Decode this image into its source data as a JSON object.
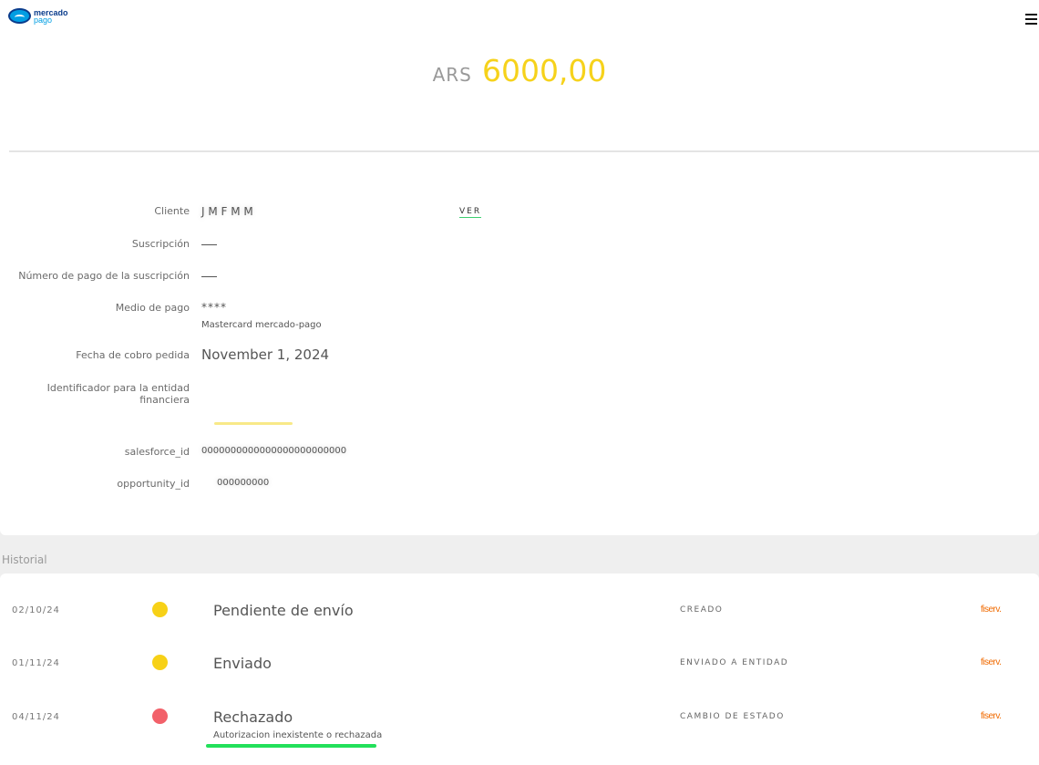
{
  "header": {
    "logo_line1": "mercado",
    "logo_line2": "pago",
    "brand_color": "#009ee3"
  },
  "amount": {
    "currency": "ARS",
    "value": "6000,00",
    "color": "#f6d21b"
  },
  "details": {
    "cliente_label": "Cliente",
    "cliente_value": "J     M  F       M  M",
    "ver_link": "VER",
    "suscripcion_label": "Suscripción",
    "numero_pago_label": "Número de pago de la suscripción",
    "medio_pago_label": "Medio de pago",
    "medio_pago_mask": "****",
    "medio_pago_desc": "Mastercard mercado-pago",
    "fecha_label": "Fecha de cobro pedida",
    "fecha_value": "November 1, 2024",
    "identificador_label": "Identificador para la entidad financiera",
    "salesforce_label": "salesforce_id",
    "salesforce_value": "0000000000000000000000000",
    "opportunity_label": "opportunity_id",
    "opportunity_value": "000000000"
  },
  "historial": {
    "title": "Historial",
    "rows": [
      {
        "date": "02/10/24",
        "status": "Pendiente de envío",
        "sub": "",
        "event": "CREADO",
        "brand": "fiserv.",
        "dot_color": "#f7d117"
      },
      {
        "date": "01/11/24",
        "status": "Enviado",
        "sub": "",
        "event": "ENVIADO A ENTIDAD",
        "brand": "fiserv.",
        "dot_color": "#f7d117"
      },
      {
        "date": "04/11/24",
        "status": "Rechazado",
        "sub": "Autorizacion inexistente o rechazada",
        "event": "CAMBIO DE ESTADO",
        "brand": "fiserv.",
        "dot_color": "#f2616a"
      }
    ]
  }
}
